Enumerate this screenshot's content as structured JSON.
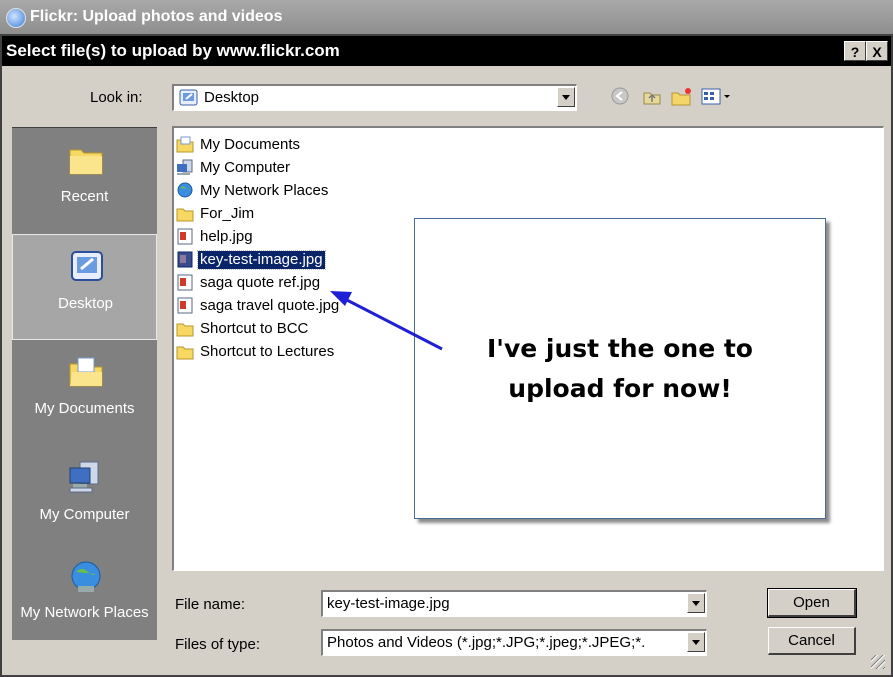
{
  "window": {
    "title": "Flickr: Upload photos and videos"
  },
  "dialog": {
    "title": "Select file(s) to upload by www.flickr.com",
    "help_button": "?",
    "close_button": "X"
  },
  "look_in": {
    "label": "Look in:",
    "value": "Desktop"
  },
  "places": [
    {
      "label": "Recent",
      "icon": "folder-icon"
    },
    {
      "label": "Desktop",
      "icon": "desktop-icon",
      "active": true
    },
    {
      "label": "My Documents",
      "icon": "documents-icon"
    },
    {
      "label": "My Computer",
      "icon": "computer-icon"
    },
    {
      "label": "My Network Places",
      "icon": "network-icon"
    }
  ],
  "files": [
    {
      "name": "My Documents",
      "icon": "documents-icon"
    },
    {
      "name": "My Computer",
      "icon": "computer-icon"
    },
    {
      "name": "My Network Places",
      "icon": "network-icon"
    },
    {
      "name": "For_Jim",
      "icon": "folder-icon"
    },
    {
      "name": "help.jpg",
      "icon": "image-file-icon"
    },
    {
      "name": "key-test-image.jpg",
      "icon": "image-file-icon",
      "selected": true
    },
    {
      "name": "saga quote ref.jpg",
      "icon": "image-file-icon"
    },
    {
      "name": "saga travel quote.jpg",
      "icon": "image-file-icon"
    },
    {
      "name": "Shortcut to BCC",
      "icon": "folder-icon"
    },
    {
      "name": "Shortcut to Lectures",
      "icon": "folder-icon"
    }
  ],
  "callout": {
    "line1": "I've just the one to",
    "line2": "upload for now!",
    "arrow_color": "#1f1fd6"
  },
  "file_name": {
    "label": "File name:",
    "value": "key-test-image.jpg"
  },
  "file_type": {
    "label": "Files of type:",
    "value": "Photos and Videos (*.jpg;*.JPG;*.jpeg;*.JPEG;*."
  },
  "buttons": {
    "open": "Open",
    "cancel": "Cancel"
  },
  "colors": {
    "selection": "#0a246a",
    "dialog_face": "#d4d0c8",
    "places_bar": "#808080"
  }
}
